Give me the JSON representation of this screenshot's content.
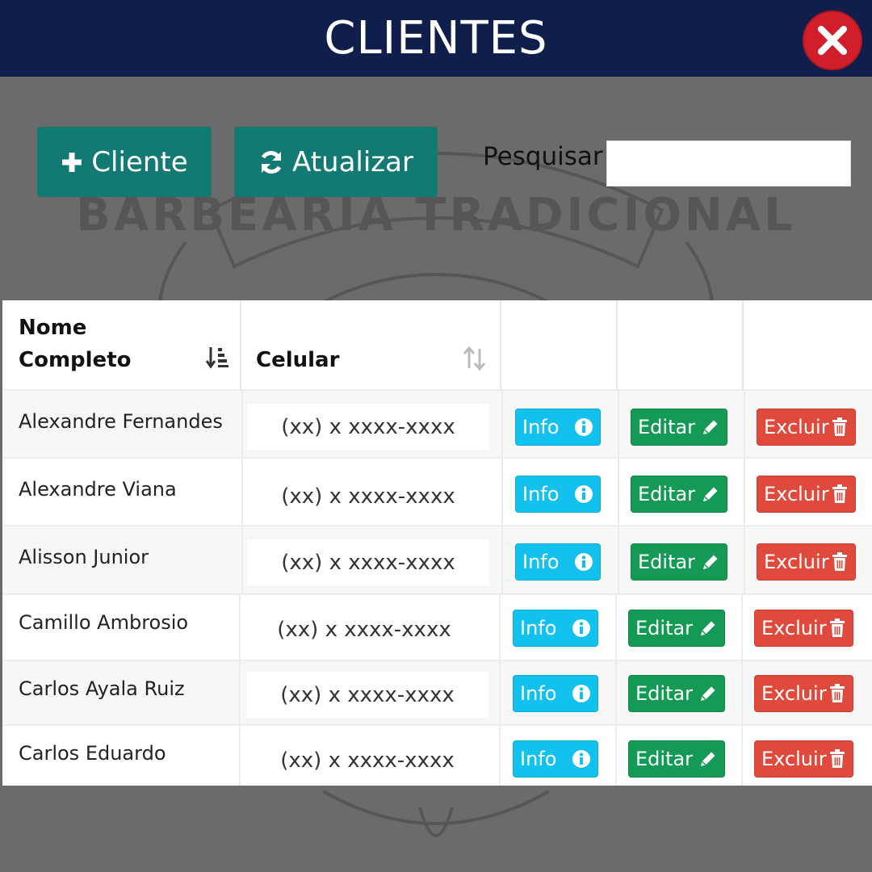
{
  "header": {
    "title": "CLIENTES"
  },
  "toolbar": {
    "add_label": "Cliente",
    "refresh_label": "Atualizar",
    "search_label": "Pesquisar",
    "search_value": ""
  },
  "background_emblem": {
    "text": "BARBEARIA TRADICIONAL"
  },
  "table": {
    "columns": [
      "Nome Completo",
      "Celular",
      "",
      "",
      ""
    ],
    "rows": [
      {
        "name": "Alexandre Fernandes",
        "phone": "(xx) x xxxx-xxxx"
      },
      {
        "name": "Alexandre Viana",
        "phone": "(xx) x xxxx-xxxx"
      },
      {
        "name": "Alisson Junior",
        "phone": "(xx) x xxxx-xxxx"
      },
      {
        "name": "Camillo Ambrosio",
        "phone": "(xx) x xxxx-xxxx"
      },
      {
        "name": "Carlos Ayala Ruiz",
        "phone": "(xx) x xxxx-xxxx"
      },
      {
        "name": "Carlos Eduardo",
        "phone": "(xx) x xxxx-xxxx"
      }
    ],
    "action_labels": {
      "info": "Info",
      "edit": "Editar",
      "delete": "Excluir"
    }
  },
  "colors": {
    "header_bg": "#0f1e4a",
    "primary_teal": "#127a72",
    "info": "#13c1ee",
    "edit": "#149a55",
    "delete": "#e04a3c",
    "close": "#d01f2a"
  }
}
